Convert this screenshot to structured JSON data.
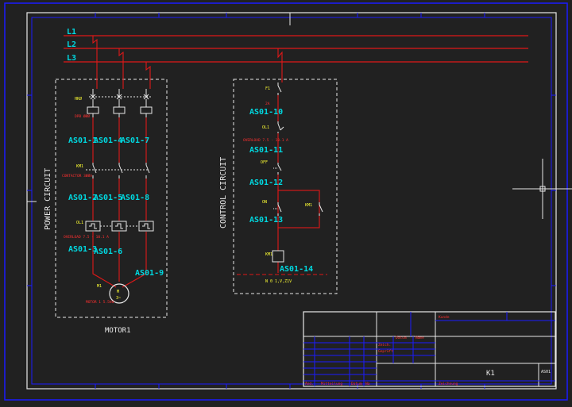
{
  "sheet": {
    "title_block_id": "K1",
    "sheet_code": "AS01"
  },
  "lines": [
    "L1",
    "L2",
    "L3"
  ],
  "power_circuit": {
    "title": "POWER CIRCUIT",
    "caption": "MOTOR1",
    "device_q": "HKØ",
    "device_q_note": "DPB ØØØ",
    "contactor_label": "KM1",
    "contactor_note": "CONTACTOR 3ØØA",
    "overload_label": "OL1",
    "overload_note": "OVERLOAD 7.5 - 10.1 A",
    "motor_tag": "M1",
    "motor_symbol": "M",
    "motor_sub": "3~",
    "motor_note": "MOTOR 1 5.5kW",
    "wires_row1": [
      "AS01-1",
      "AS01-4",
      "AS01-7"
    ],
    "wires_row2": [
      "AS01-2",
      "AS01-5",
      "AS01-8"
    ],
    "wire_row3_left": "AS01-3",
    "wire_row3_mid": "AS01-6",
    "wire_row3_right": "AS01-9"
  },
  "control_circuit": {
    "title": "CONTROL CIRCUIT",
    "fuse_label": "F1",
    "fuse_note": "2A",
    "overload_label": "OL1",
    "overload_note": "OVERLOAD 7.5 - 10.1 A",
    "stop_label": "OFF",
    "start_label": "ON",
    "hold_label": "KM1",
    "coil_label": "KM1",
    "neutral_note": "N 0 1,V,Z1V",
    "wires": [
      "AS01-10",
      "AS01-11",
      "AS01-12",
      "AS01-13",
      "AS01-14"
    ]
  },
  "title_block": {
    "label_a": "Zeich.",
    "label_b": "Geprüft",
    "label_c": "Datum",
    "label_d": "Name",
    "row_bottom": [
      "Änd.",
      "Mitteilung",
      "Datum",
      "Na"
    ],
    "customer_label": "Kunde",
    "drawing_label": "Zeichnung"
  },
  "colors": {
    "background": "#212121",
    "wire": "#e01818",
    "wire_label": "#00d8e0",
    "frame": "#1a1aff",
    "annotation": "#ffff33",
    "dashed_box": "#e8e8e8"
  },
  "icons": [
    "crosshair-cursor-icon"
  ]
}
